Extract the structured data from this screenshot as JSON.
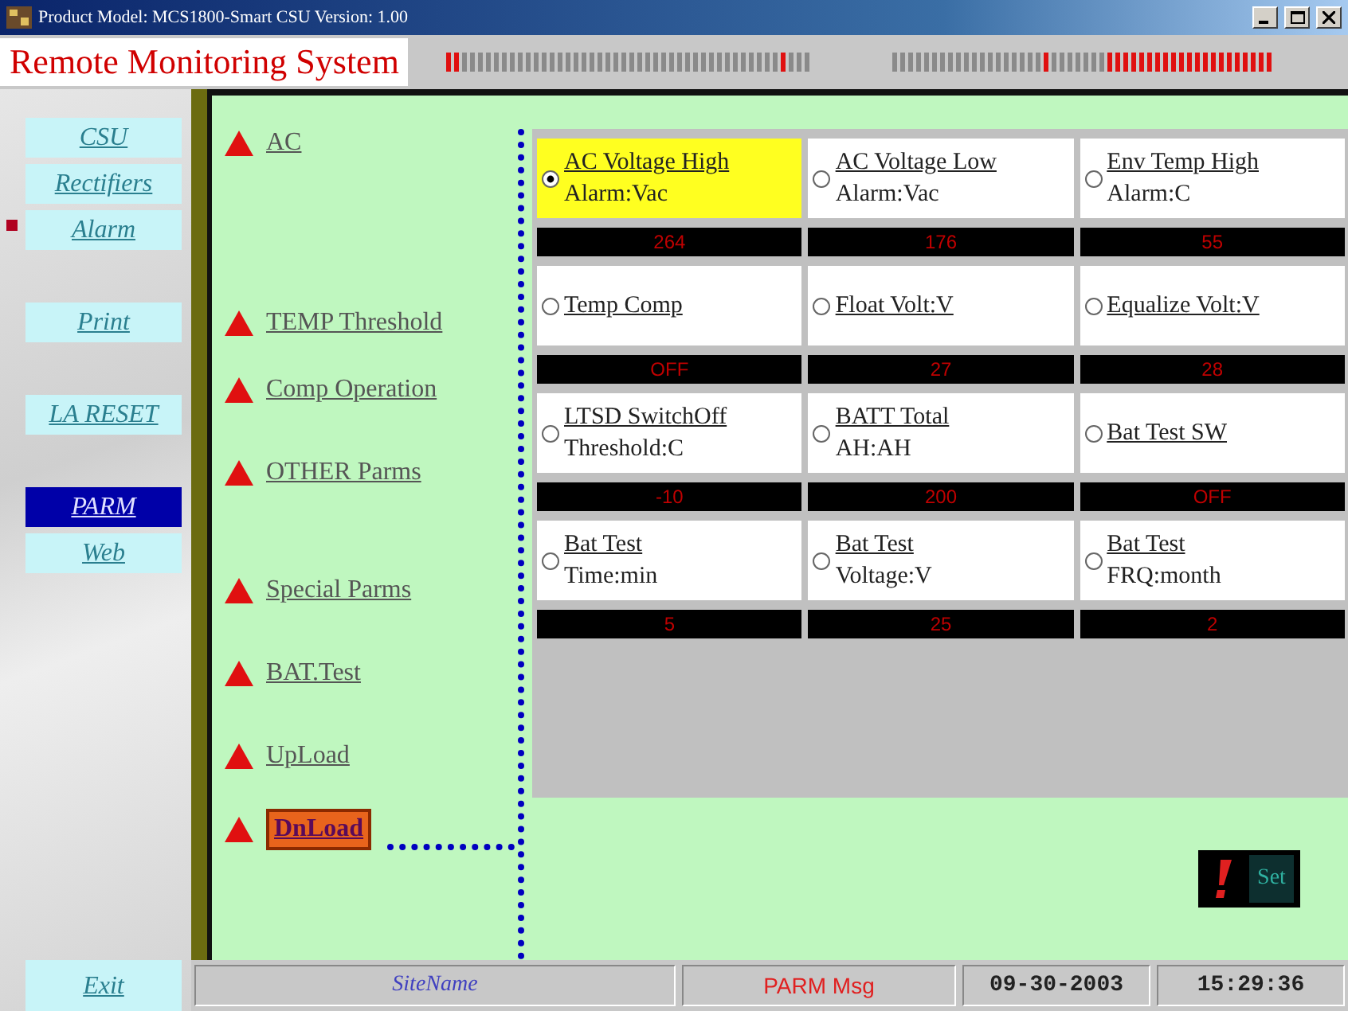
{
  "window": {
    "title": "Product Model: MCS1800-Smart CSU Version: 1.00"
  },
  "header": {
    "title": "Remote Monitoring System"
  },
  "sidebar": {
    "items": [
      {
        "label": "CSU",
        "selected": false,
        "flagged": false
      },
      {
        "label": "Rectifiers",
        "selected": false,
        "flagged": false
      },
      {
        "label": "Alarm",
        "selected": false,
        "flagged": true
      },
      {
        "label": "Print",
        "selected": false,
        "flagged": false
      },
      {
        "label": "LA RESET",
        "selected": false,
        "flagged": false
      },
      {
        "label": "PARM",
        "selected": true,
        "flagged": false
      },
      {
        "label": "Web",
        "selected": false,
        "flagged": false
      },
      {
        "label": "Exit",
        "selected": false,
        "flagged": false
      }
    ]
  },
  "menu": {
    "items": [
      {
        "label": "AC",
        "selected": false
      },
      {
        "label": "TEMP Threshold",
        "selected": false
      },
      {
        "label": "Comp Operation",
        "selected": false
      },
      {
        "label": "OTHER Parms",
        "selected": false
      },
      {
        "label": "Special Parms",
        "selected": false
      },
      {
        "label": "BAT.Test",
        "selected": false
      },
      {
        "label": "UpLoad",
        "selected": false
      },
      {
        "label": "DnLoad",
        "selected": true
      }
    ]
  },
  "params": [
    {
      "name": "AC Voltage High",
      "unit": "Alarm:Vac",
      "reading": "264",
      "selected": true
    },
    {
      "name": "AC Voltage Low",
      "unit": "Alarm:Vac",
      "reading": "176",
      "selected": false
    },
    {
      "name": "Env Temp High",
      "unit": "Alarm:C",
      "reading": "55",
      "selected": false
    },
    {
      "name": "Temp Comp",
      "reading": "OFF",
      "selected": false
    },
    {
      "name": "Float Volt:V",
      "reading": "27",
      "selected": false
    },
    {
      "name": "Equalize Volt:V",
      "reading": "28",
      "selected": false
    },
    {
      "name": "LTSD SwitchOff",
      "unit": "Threshold:C",
      "reading": "-10",
      "selected": false
    },
    {
      "name": "BATT Total",
      "unit": "AH:AH",
      "reading": "200",
      "selected": false
    },
    {
      "name": "Bat Test SW",
      "reading": "OFF",
      "selected": false
    },
    {
      "name": "Bat Test",
      "unit": "Time:min",
      "reading": "5",
      "selected": false
    },
    {
      "name": "Bat Test",
      "unit": "Voltage:V",
      "reading": "25",
      "selected": false
    },
    {
      "name": "Bat Test",
      "unit": "FRQ:month",
      "reading": "2",
      "selected": false
    }
  ],
  "set_button": {
    "label": "Set"
  },
  "status_bar": {
    "site_name": "SiteName",
    "message": "PARM Msg",
    "date": "09-30-2003",
    "time": "15:29:36"
  }
}
